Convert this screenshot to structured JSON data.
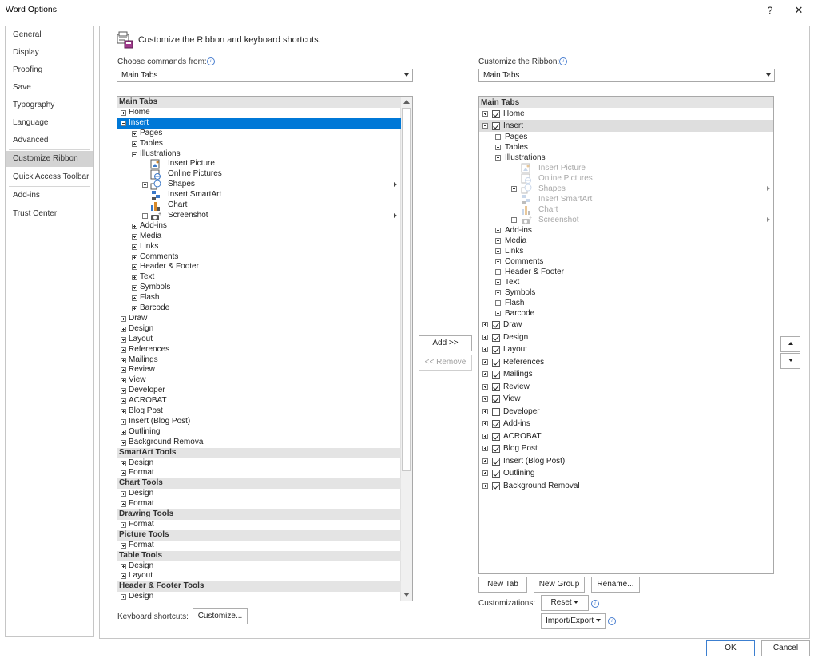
{
  "window": {
    "title": "Word Options",
    "help": "?",
    "close": "✕"
  },
  "categories": [
    {
      "label": "General"
    },
    {
      "label": "Display"
    },
    {
      "label": "Proofing"
    },
    {
      "label": "Save"
    },
    {
      "label": "Typography"
    },
    {
      "label": "Language"
    },
    {
      "label": "Advanced"
    },
    {
      "label": "Customize Ribbon",
      "selected": true
    },
    {
      "label": "Quick Access Toolbar"
    },
    {
      "label": "Add-ins"
    },
    {
      "label": "Trust Center"
    }
  ],
  "header": {
    "title": "Customize the Ribbon and keyboard shortcuts."
  },
  "left": {
    "label": "Choose commands from:",
    "combo_value": "Main Tabs",
    "items": [
      {
        "t": "Main Tabs",
        "lvl": 0,
        "hdr": true
      },
      {
        "t": "Home",
        "lvl": 1,
        "exp": "plus"
      },
      {
        "t": "Insert",
        "lvl": 1,
        "exp": "minus",
        "sel": true
      },
      {
        "t": "Pages",
        "lvl": 2,
        "exp": "plus"
      },
      {
        "t": "Tables",
        "lvl": 2,
        "exp": "plus"
      },
      {
        "t": "Illustrations",
        "lvl": 2,
        "exp": "minus"
      },
      {
        "t": "Insert Picture",
        "lvl": 3,
        "icon": "picture"
      },
      {
        "t": "Online Pictures",
        "lvl": 3,
        "icon": "online"
      },
      {
        "t": "Shapes",
        "lvl": 3,
        "icon": "shapes",
        "exp": "plus",
        "sub": true
      },
      {
        "t": "Insert SmartArt",
        "lvl": 3,
        "icon": "smartart"
      },
      {
        "t": "Chart",
        "lvl": 3,
        "icon": "chart"
      },
      {
        "t": "Screenshot",
        "lvl": 3,
        "icon": "screenshot",
        "exp": "plus",
        "sub": true
      },
      {
        "t": "Add-ins",
        "lvl": 2,
        "exp": "plus"
      },
      {
        "t": "Media",
        "lvl": 2,
        "exp": "plus"
      },
      {
        "t": "Links",
        "lvl": 2,
        "exp": "plus"
      },
      {
        "t": "Comments",
        "lvl": 2,
        "exp": "plus"
      },
      {
        "t": "Header & Footer",
        "lvl": 2,
        "exp": "plus"
      },
      {
        "t": "Text",
        "lvl": 2,
        "exp": "plus"
      },
      {
        "t": "Symbols",
        "lvl": 2,
        "exp": "plus"
      },
      {
        "t": "Flash",
        "lvl": 2,
        "exp": "plus"
      },
      {
        "t": "Barcode",
        "lvl": 2,
        "exp": "plus"
      },
      {
        "t": "Draw",
        "lvl": 1,
        "exp": "plus"
      },
      {
        "t": "Design",
        "lvl": 1,
        "exp": "plus"
      },
      {
        "t": "Layout",
        "lvl": 1,
        "exp": "plus"
      },
      {
        "t": "References",
        "lvl": 1,
        "exp": "plus"
      },
      {
        "t": "Mailings",
        "lvl": 1,
        "exp": "plus"
      },
      {
        "t": "Review",
        "lvl": 1,
        "exp": "plus"
      },
      {
        "t": "View",
        "lvl": 1,
        "exp": "plus"
      },
      {
        "t": "Developer",
        "lvl": 1,
        "exp": "plus"
      },
      {
        "t": "ACROBAT",
        "lvl": 1,
        "exp": "plus"
      },
      {
        "t": "Blog Post",
        "lvl": 1,
        "exp": "plus"
      },
      {
        "t": "Insert (Blog Post)",
        "lvl": 1,
        "exp": "plus"
      },
      {
        "t": "Outlining",
        "lvl": 1,
        "exp": "plus"
      },
      {
        "t": "Background Removal",
        "lvl": 1,
        "exp": "plus"
      },
      {
        "t": "SmartArt Tools",
        "lvl": 0,
        "hdr": true
      },
      {
        "t": "Design",
        "lvl": 1,
        "exp": "plus"
      },
      {
        "t": "Format",
        "lvl": 1,
        "exp": "plus"
      },
      {
        "t": "Chart Tools",
        "lvl": 0,
        "hdr": true
      },
      {
        "t": "Design",
        "lvl": 1,
        "exp": "plus"
      },
      {
        "t": "Format",
        "lvl": 1,
        "exp": "plus"
      },
      {
        "t": "Drawing Tools",
        "lvl": 0,
        "hdr": true
      },
      {
        "t": "Format",
        "lvl": 1,
        "exp": "plus"
      },
      {
        "t": "Picture Tools",
        "lvl": 0,
        "hdr": true
      },
      {
        "t": "Format",
        "lvl": 1,
        "exp": "plus"
      },
      {
        "t": "Table Tools",
        "lvl": 0,
        "hdr": true
      },
      {
        "t": "Design",
        "lvl": 1,
        "exp": "plus"
      },
      {
        "t": "Layout",
        "lvl": 1,
        "exp": "plus"
      },
      {
        "t": "Header & Footer Tools",
        "lvl": 0,
        "hdr": true
      },
      {
        "t": "Design",
        "lvl": 1,
        "exp": "plus"
      }
    ]
  },
  "right": {
    "label": "Customize the Ribbon:",
    "combo_value": "Main Tabs",
    "items": [
      {
        "t": "Main Tabs",
        "lvl": 0,
        "hdr": true,
        "h": 13
      },
      {
        "t": "Home",
        "lvl": 1,
        "exp": "plus",
        "chk": true,
        "h": 15
      },
      {
        "t": "Insert",
        "lvl": 1,
        "exp": "minus",
        "chk": true,
        "selgray": true,
        "h": 15
      },
      {
        "t": "Pages",
        "lvl": 2,
        "exp": "plus",
        "h": 13
      },
      {
        "t": "Tables",
        "lvl": 2,
        "exp": "plus",
        "h": 13
      },
      {
        "t": "Illustrations",
        "lvl": 2,
        "exp": "minus",
        "h": 13
      },
      {
        "t": "Insert Picture",
        "lvl": 3,
        "icon": "picture",
        "gray": true,
        "h": 13
      },
      {
        "t": "Online Pictures",
        "lvl": 3,
        "icon": "online",
        "gray": true,
        "h": 13
      },
      {
        "t": "Shapes",
        "lvl": 3,
        "icon": "shapes",
        "exp": "plus",
        "sub": true,
        "gray": true,
        "h": 13
      },
      {
        "t": "Insert SmartArt",
        "lvl": 3,
        "icon": "smartart",
        "gray": true,
        "h": 13
      },
      {
        "t": "Chart",
        "lvl": 3,
        "icon": "chart",
        "gray": true,
        "h": 13
      },
      {
        "t": "Screenshot",
        "lvl": 3,
        "icon": "screenshot",
        "exp": "plus",
        "sub": true,
        "gray": true,
        "h": 13
      },
      {
        "t": "Add-ins",
        "lvl": 2,
        "exp": "plus",
        "h": 13
      },
      {
        "t": "Media",
        "lvl": 2,
        "exp": "plus",
        "h": 13
      },
      {
        "t": "Links",
        "lvl": 2,
        "exp": "plus",
        "h": 13
      },
      {
        "t": "Comments",
        "lvl": 2,
        "exp": "plus",
        "h": 13
      },
      {
        "t": "Header & Footer",
        "lvl": 2,
        "exp": "plus",
        "h": 13
      },
      {
        "t": "Text",
        "lvl": 2,
        "exp": "plus",
        "h": 13
      },
      {
        "t": "Symbols",
        "lvl": 2,
        "exp": "plus",
        "h": 13
      },
      {
        "t": "Flash",
        "lvl": 2,
        "exp": "plus",
        "h": 13
      },
      {
        "t": "Barcode",
        "lvl": 2,
        "exp": "plus",
        "h": 13
      },
      {
        "t": "Draw",
        "lvl": 1,
        "exp": "plus",
        "chk": true,
        "h": 15.5
      },
      {
        "t": "Design",
        "lvl": 1,
        "exp": "plus",
        "chk": true,
        "h": 15.5
      },
      {
        "t": "Layout",
        "lvl": 1,
        "exp": "plus",
        "chk": true,
        "h": 15.5
      },
      {
        "t": "References",
        "lvl": 1,
        "exp": "plus",
        "chk": true,
        "h": 15.5
      },
      {
        "t": "Mailings",
        "lvl": 1,
        "exp": "plus",
        "chk": true,
        "h": 15.5
      },
      {
        "t": "Review",
        "lvl": 1,
        "exp": "plus",
        "chk": true,
        "h": 15.5
      },
      {
        "t": "View",
        "lvl": 1,
        "exp": "plus",
        "chk": true,
        "h": 15.5
      },
      {
        "t": "Developer",
        "lvl": 1,
        "exp": "plus",
        "chk": false,
        "h": 15.5
      },
      {
        "t": "Add-ins",
        "lvl": 1,
        "exp": "plus",
        "chk": true,
        "h": 15.5
      },
      {
        "t": "ACROBAT",
        "lvl": 1,
        "exp": "plus",
        "chk": true,
        "h": 15.5
      },
      {
        "t": "Blog Post",
        "lvl": 1,
        "exp": "plus",
        "chk": true,
        "h": 15.5
      },
      {
        "t": "Insert (Blog Post)",
        "lvl": 1,
        "exp": "plus",
        "chk": true,
        "h": 15.5
      },
      {
        "t": "Outlining",
        "lvl": 1,
        "exp": "plus",
        "chk": true,
        "h": 15.5
      },
      {
        "t": "Background Removal",
        "lvl": 1,
        "exp": "plus",
        "chk": true,
        "h": 15.5
      }
    ]
  },
  "buttons": {
    "add": "Add >>",
    "remove": "<< Remove",
    "new_tab": "New Tab",
    "new_group": "New Group",
    "rename": "Rename...",
    "customizations_label": "Customizations:",
    "reset": "Reset",
    "import_export": "Import/Export",
    "keyboard_label": "Keyboard shortcuts:",
    "customize": "Customize...",
    "ok": "OK",
    "cancel": "Cancel"
  },
  "colors": {
    "selection": "#0078d7",
    "header_row": "#e4e4e4",
    "category_selected": "#d3d3d3"
  }
}
